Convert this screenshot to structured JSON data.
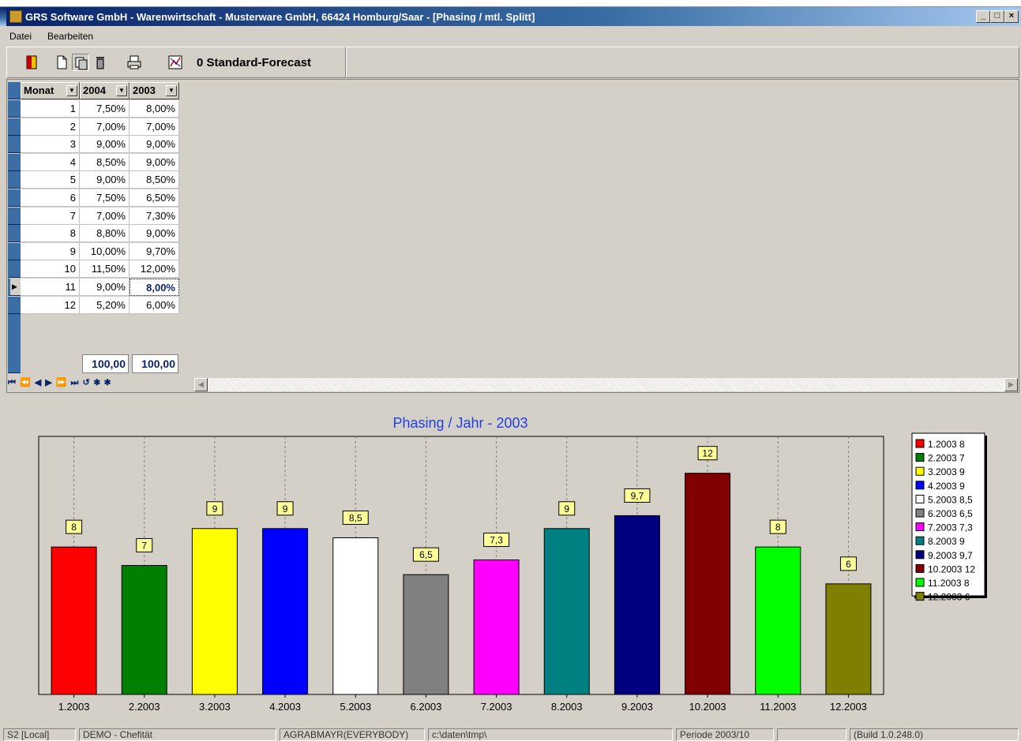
{
  "window": {
    "title": "GRS Software GmbH - Warenwirtschaft - Musterware GmbH, 66424 Homburg/Saar - [Phasing / mtl. Splitt]",
    "icon": "app-icon",
    "controls": [
      "_",
      "&",
      "X"
    ]
  },
  "menu": {
    "items": [
      "Datei",
      "Bearbeiten"
    ]
  },
  "toolbar": {
    "buttons": [
      "exit-icon",
      "new-document-icon",
      "copy-icon",
      "delete-icon",
      "print-icon",
      "chart-icon"
    ],
    "forecast_label": "0 Standard-Forecast"
  },
  "grid": {
    "columns": [
      "Monat",
      "2004",
      "2003"
    ],
    "rows": [
      {
        "monat": "1",
        "y2004": "7,50%",
        "y2003": "8,00%"
      },
      {
        "monat": "2",
        "y2004": "7,00%",
        "y2003": "7,00%"
      },
      {
        "monat": "3",
        "y2004": "9,00%",
        "y2003": "9,00%"
      },
      {
        "monat": "4",
        "y2004": "8,50%",
        "y2003": "9,00%"
      },
      {
        "monat": "5",
        "y2004": "9,00%",
        "y2003": "8,50%"
      },
      {
        "monat": "6",
        "y2004": "7,50%",
        "y2003": "6,50%"
      },
      {
        "monat": "7",
        "y2004": "7,00%",
        "y2003": "7,30%"
      },
      {
        "monat": "8",
        "y2004": "8,80%",
        "y2003": "9,00%"
      },
      {
        "monat": "9",
        "y2004": "10,00%",
        "y2003": "9,70%"
      },
      {
        "monat": "10",
        "y2004": "11,50%",
        "y2003": "12,00%"
      },
      {
        "monat": "11",
        "y2004": "9,00%",
        "y2003": "8,00%"
      },
      {
        "monat": "12",
        "y2004": "5,20%",
        "y2003": "6,00%"
      }
    ],
    "selected_row": 11,
    "totals": {
      "y2004": "100,00",
      "y2003": "100,00"
    },
    "navigator": "⏮ ⏪ ◀ ▶ ⏩ ⏭ ↺ ✱ ✱"
  },
  "chart_data": {
    "type": "bar",
    "title": "Phasing / Jahr - 2003",
    "categories": [
      "1.2003",
      "2.2003",
      "3.2003",
      "4.2003",
      "5.2003",
      "6.2003",
      "7.2003",
      "8.2003",
      "9.2003",
      "10.2003",
      "11.2003",
      "12.2003"
    ],
    "values": [
      8,
      7,
      9,
      9,
      8.5,
      6.5,
      7.3,
      9,
      9.7,
      12,
      8,
      6
    ],
    "data_labels": [
      "8",
      "7",
      "9",
      "9",
      "8,5",
      "6,5",
      "7,3",
      "9",
      "9,7",
      "12",
      "8",
      "6"
    ],
    "colors": [
      "#ff0000",
      "#008000",
      "#ffff00",
      "#0000ff",
      "#ffffff",
      "#808080",
      "#ff00ff",
      "#008080",
      "#000080",
      "#800000",
      "#00ff00",
      "#808000"
    ],
    "legend": [
      "1.2003 8",
      "2.2003 7",
      "3.2003 9",
      "4.2003 9",
      "5.2003 8,5",
      "6.2003 6,5",
      "7.2003 7,3",
      "8.2003 9",
      "9.2003 9,7",
      "10.2003 12",
      "11.2003 8",
      "12.2003 6"
    ],
    "legend_position": "right",
    "ylim": [
      0,
      14
    ],
    "grid": false
  },
  "status": {
    "fields": [
      "S2 [Local]",
      "DEMO - Chefität",
      "AGRABMAYR(EVERYBODY)",
      "c:\\daten\\tmp\\",
      "Periode 2003/10",
      "",
      "(Build 1.0.248.0)"
    ]
  }
}
